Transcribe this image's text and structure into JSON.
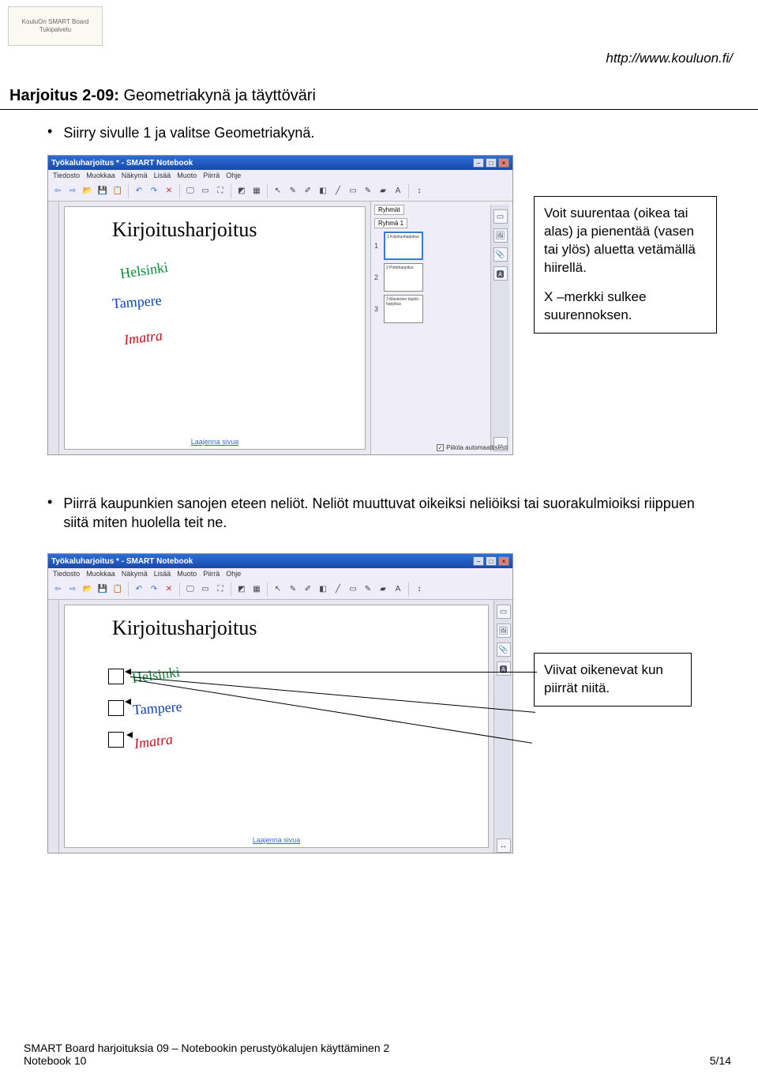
{
  "header": {
    "logo_text": "KouluOn SMART Board Tukipalvelu",
    "url": "http://www.kouluon.fi/"
  },
  "heading": {
    "prefix": "Harjoitus 2-09:",
    "rest": " Geometriakynä ja täyttöväri"
  },
  "bullet1": "Siirry sivulle 1 ja valitse Geometriakynä.",
  "callout1_line1": "Voit suurentaa (oikea tai alas) ja pienentää (vasen tai ylös) aluetta vetämällä hiirellä.",
  "callout1_line2": "X –merkki sulkee suurennoksen.",
  "bullet2": "Piirrä kaupunkien sanojen eteen neliöt. Neliöt muuttuvat oikeiksi neliöiksi tai suorakulmioiksi riippuen siitä miten huolella teit ne.",
  "callout2": "Viivat oikenevat kun piirrät niitä.",
  "screenshot": {
    "title": "Työkaluharjoitus * - SMART Notebook",
    "menus": [
      "Tiedosto",
      "Muokkaa",
      "Näkymä",
      "Lisää",
      "Muoto",
      "Piirrä",
      "Ohje"
    ],
    "canvas_title": "Kirjoitusharjoitus",
    "cities": {
      "helsinki": "Helsinki",
      "tampere": "Tampere",
      "imatra": "Imatra"
    },
    "side_tabs": [
      "Ryhmät",
      "Ryhmä 1"
    ],
    "thumb_labels": [
      "1 Kirjoitusharjoitus",
      "2 Piirtoharjoitus",
      "3 Masterien käyttö -harjoitus"
    ],
    "footer_link": "Laajenna sivua",
    "footer_chk": "Piilota automaattisesti"
  },
  "footer": {
    "line1": "SMART Board harjoituksia 09 – Notebookin perustyökalujen käyttäminen 2",
    "line2": "Notebook 10",
    "page": "5/14"
  }
}
